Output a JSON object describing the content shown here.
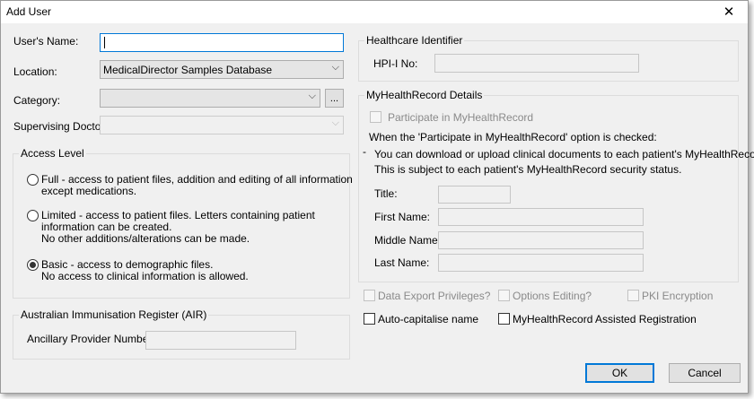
{
  "window": {
    "title": "Add User",
    "close_glyph": "✕"
  },
  "left": {
    "users_name_label": "User's Name:",
    "users_name_value": "",
    "location_label": "Location:",
    "location_value": "MedicalDirector Samples Database",
    "category_label": "Category:",
    "category_value": "",
    "category_more": "...",
    "supervising_label": "Supervising Doctor:",
    "supervising_value": ""
  },
  "access_level": {
    "title": "Access Level",
    "options": [
      {
        "lines": [
          "Full - access to patient files, addition and editing of all information",
          "except medications."
        ],
        "checked": false
      },
      {
        "lines": [
          "Limited - access to patient files.  Letters containing patient",
          "information can be created.",
          "No other additions/alterations can be made."
        ],
        "checked": false
      },
      {
        "lines": [
          "Basic - access to demographic files.",
          "No access to clinical information is allowed."
        ],
        "checked": true
      }
    ]
  },
  "air": {
    "title": "Australian Immunisation Register (AIR)",
    "provider_label": "Ancillary Provider Number:",
    "provider_value": ""
  },
  "hi": {
    "title": "Healthcare Identifier",
    "hpii_label": "HPI-I No:",
    "hpii_value": ""
  },
  "mhr": {
    "title": "MyHealthRecord Details",
    "participate_label": "Participate in MyHealthRecord",
    "note_intro": "When the 'Participate in MyHealthRecord' option is checked:",
    "bullet": "-",
    "note_line1": "You can download or upload clinical documents to each patient's MyHealthRecord.",
    "note_line2": "This is subject to each patient's MyHealthRecord security status.",
    "title_label": "Title:",
    "first_name_label": "First Name:",
    "middle_name_label": "Middle Name:",
    "last_name_label": "Last Name:"
  },
  "options": {
    "data_export": "Data Export Privileges?",
    "options_editing": "Options Editing?",
    "pki": "PKI Encryption",
    "auto_cap": "Auto-capitalise name",
    "mhr_assisted": "MyHealthRecord Assisted Registration"
  },
  "buttons": {
    "ok": "OK",
    "cancel": "Cancel"
  },
  "icons": {
    "dropdown": "⌵"
  }
}
